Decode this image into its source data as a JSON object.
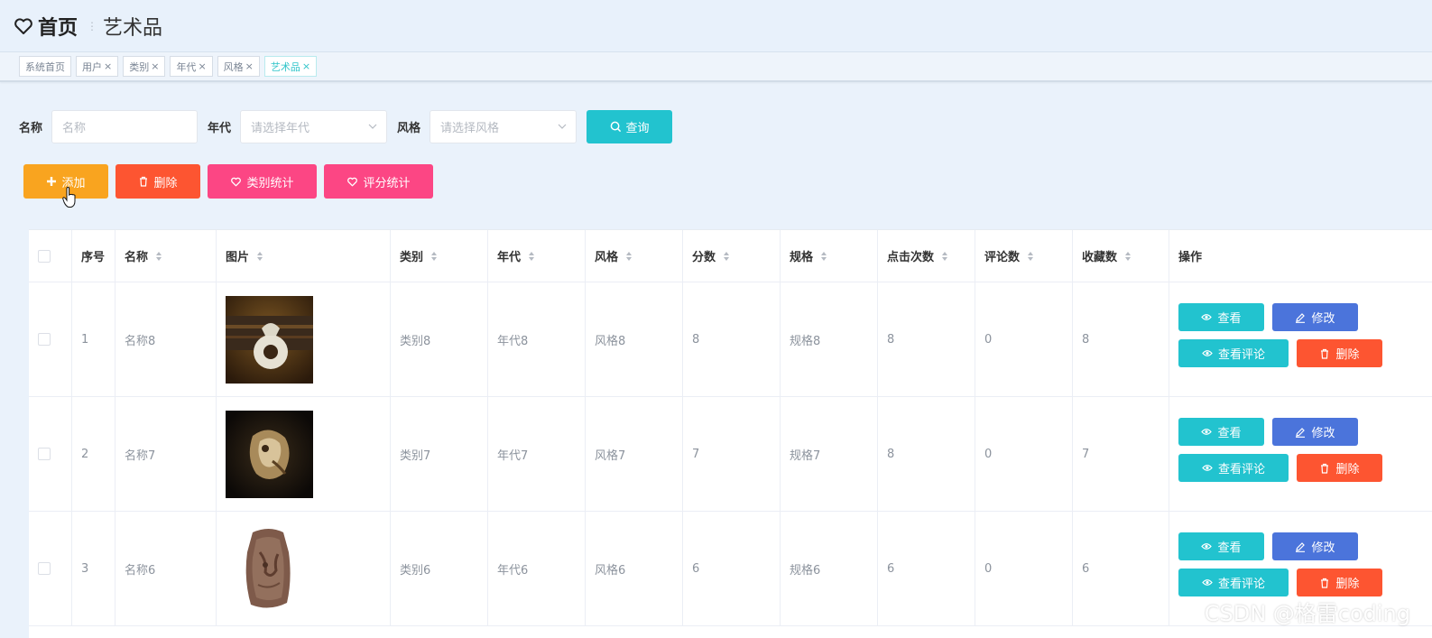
{
  "header": {
    "home": "首页",
    "current": "艺术品"
  },
  "tags": [
    {
      "label": "系统首页",
      "closable": false,
      "active": false
    },
    {
      "label": "用户",
      "closable": true,
      "active": false
    },
    {
      "label": "类别",
      "closable": true,
      "active": false
    },
    {
      "label": "年代",
      "closable": true,
      "active": false
    },
    {
      "label": "风格",
      "closable": true,
      "active": false
    },
    {
      "label": "艺术品",
      "closable": true,
      "active": true
    }
  ],
  "tag_close": "×",
  "search": {
    "name_label": "名称",
    "name_placeholder": "名称",
    "era_label": "年代",
    "era_placeholder": "请选择年代",
    "style_label": "风格",
    "style_placeholder": "请选择风格",
    "query": "查询"
  },
  "actions": {
    "add": "添加",
    "delete": "删除",
    "category_stats": "类别统计",
    "rating_stats": "评分统计"
  },
  "columns": [
    "序号",
    "名称",
    "图片",
    "类别",
    "年代",
    "风格",
    "分数",
    "规格",
    "点击次数",
    "评论数",
    "收藏数",
    "操作"
  ],
  "rows": [
    {
      "index": "1",
      "name": "名称8",
      "category": "类别8",
      "era": "年代8",
      "style": "风格8",
      "score": "8",
      "spec": "规格8",
      "clicks": "8",
      "comments": "0",
      "favorites": "8"
    },
    {
      "index": "2",
      "name": "名称7",
      "category": "类别7",
      "era": "年代7",
      "style": "风格7",
      "score": "7",
      "spec": "规格7",
      "clicks": "8",
      "comments": "0",
      "favorites": "7"
    },
    {
      "index": "3",
      "name": "名称6",
      "category": "类别6",
      "era": "年代6",
      "style": "风格6",
      "score": "6",
      "spec": "规格6",
      "clicks": "6",
      "comments": "0",
      "favorites": "6"
    }
  ],
  "row_actions": {
    "view": "查看",
    "edit": "修改",
    "view_comments": "查看评论",
    "delete": "删除"
  },
  "watermark": "CSDN @格雷coding",
  "colors": {
    "teal": "#22c3cf",
    "blue": "#4b74db",
    "red": "#fd5531",
    "orange": "#f9a41f",
    "pink": "#fc4684"
  }
}
